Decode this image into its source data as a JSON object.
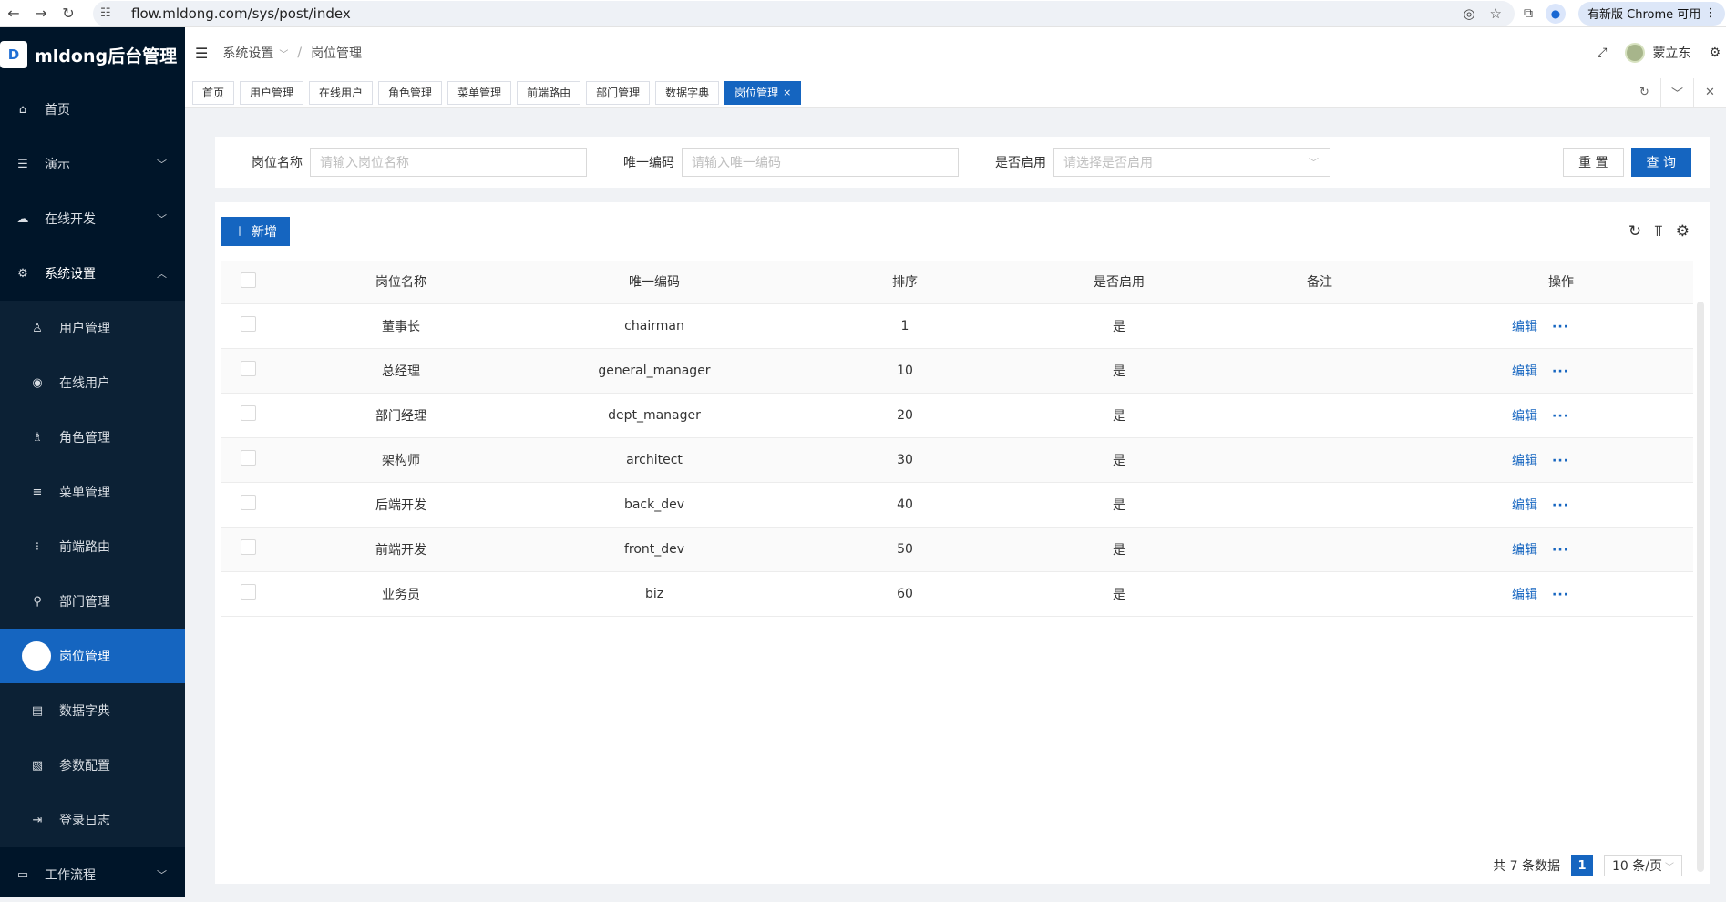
{
  "browser": {
    "url": "flow.mldong.com/sys/post/index",
    "update_label": "有新版 Chrome 可用"
  },
  "app": {
    "logo_letter": "D",
    "title": "mldong后台管理"
  },
  "sidebar": {
    "items": [
      {
        "label": "首页",
        "icon": "home-icon"
      },
      {
        "label": "演示",
        "icon": "list-icon"
      },
      {
        "label": "在线开发",
        "icon": "cloud-icon"
      },
      {
        "label": "系统设置",
        "icon": "gear-icon"
      }
    ],
    "submenu": [
      {
        "label": "用户管理",
        "icon": "user-icon"
      },
      {
        "label": "在线用户",
        "icon": "online-icon"
      },
      {
        "label": "角色管理",
        "icon": "role-icon"
      },
      {
        "label": "菜单管理",
        "icon": "menu-icon"
      },
      {
        "label": "前端路由",
        "icon": "route-icon"
      },
      {
        "label": "部门管理",
        "icon": "org-icon"
      },
      {
        "label": "岗位管理",
        "icon": "post-icon"
      },
      {
        "label": "数据字典",
        "icon": "dict-icon"
      },
      {
        "label": "参数配置",
        "icon": "config-icon"
      },
      {
        "label": "登录日志",
        "icon": "log-icon"
      }
    ],
    "last": {
      "label": "工作流程",
      "icon": "monitor-icon"
    }
  },
  "header": {
    "breadcrumb_parent": "系统设置",
    "breadcrumb_current": "岗位管理",
    "user_name": "蒙立东"
  },
  "tabs": [
    "首页",
    "用户管理",
    "在线用户",
    "角色管理",
    "菜单管理",
    "前端路由",
    "部门管理",
    "数据字典",
    "岗位管理"
  ],
  "search": {
    "name_label": "岗位名称",
    "name_placeholder": "请输入岗位名称",
    "code_label": "唯一编码",
    "code_placeholder": "请输入唯一编码",
    "enabled_label": "是否启用",
    "enabled_placeholder": "请选择是否启用",
    "reset_label": "重 置",
    "query_label": "查 询"
  },
  "toolbar": {
    "add_label": "新增"
  },
  "table": {
    "columns": [
      "岗位名称",
      "唯一编码",
      "排序",
      "是否启用",
      "备注",
      "操作"
    ],
    "rows": [
      {
        "name": "董事长",
        "code": "chairman",
        "sort": "1",
        "enabled": "是",
        "remark": ""
      },
      {
        "name": "总经理",
        "code": "general_manager",
        "sort": "10",
        "enabled": "是",
        "remark": ""
      },
      {
        "name": "部门经理",
        "code": "dept_manager",
        "sort": "20",
        "enabled": "是",
        "remark": ""
      },
      {
        "name": "架构师",
        "code": "architect",
        "sort": "30",
        "enabled": "是",
        "remark": ""
      },
      {
        "name": "后端开发",
        "code": "back_dev",
        "sort": "40",
        "enabled": "是",
        "remark": ""
      },
      {
        "name": "前端开发",
        "code": "front_dev",
        "sort": "50",
        "enabled": "是",
        "remark": ""
      },
      {
        "name": "业务员",
        "code": "biz",
        "sort": "60",
        "enabled": "是",
        "remark": ""
      }
    ],
    "edit_label": "编辑",
    "more_label": "···"
  },
  "pagination": {
    "total_text": "共 7 条数据",
    "current_page": "1",
    "page_size": "10 条/页"
  },
  "colors": {
    "sidebar_bg": "#001529",
    "primary": "#1565c0"
  }
}
